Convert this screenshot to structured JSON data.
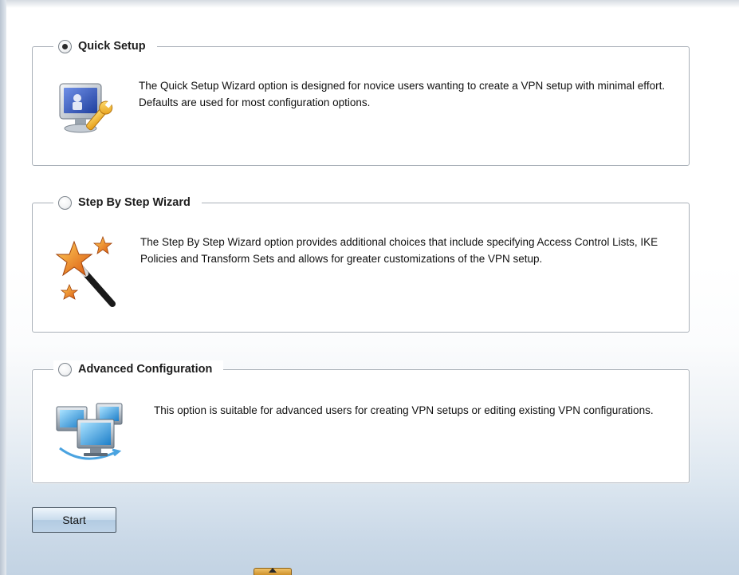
{
  "options": {
    "quick": {
      "label": "Quick Setup",
      "selected": true,
      "description": "The Quick Setup Wizard option is designed for novice users wanting to create a VPN setup with minimal effort. Defaults are used for most configuration options.",
      "icon": "computer-wrench-icon"
    },
    "step": {
      "label": "Step By Step Wizard",
      "selected": false,
      "description": "The Step By Step Wizard option provides additional choices that include specifying Access Control Lists, IKE Policies and Transform Sets and allows for greater customizations of the VPN setup.",
      "icon": "magic-wand-stars-icon"
    },
    "advanced": {
      "label": "Advanced Configuration",
      "selected": false,
      "description": "This option is suitable for advanced users for creating VPN setups or editing existing VPN configurations.",
      "icon": "networked-computers-icon"
    }
  },
  "start_button": {
    "label": "Start"
  },
  "colors": {
    "border": "#a9b0b8",
    "button_top": "#eef5fb",
    "button_bottom": "#b2cbe2",
    "background_bottom": "#c3d3e3"
  }
}
